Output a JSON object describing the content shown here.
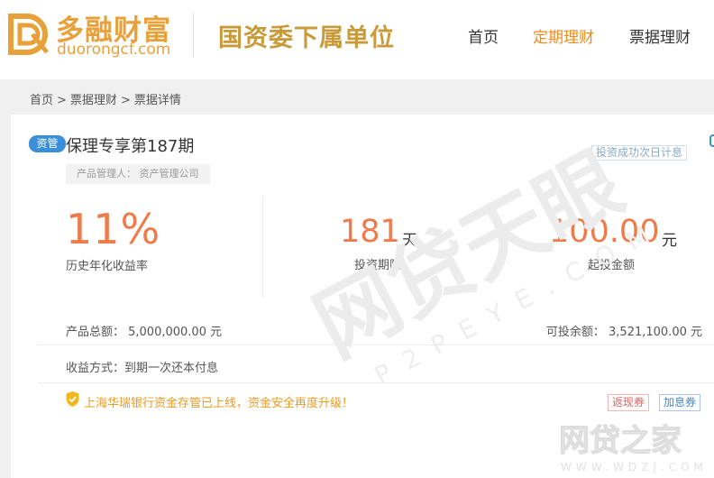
{
  "header": {
    "logo_cn": "多融财富",
    "logo_en": "duorongcf.com",
    "slogan": "国资委下属单位",
    "nav": [
      {
        "label": "首页"
      },
      {
        "label": "定期理财"
      },
      {
        "label": "票据理财"
      }
    ],
    "active_color": "#f08a1d",
    "brand_color": "#e8a13a"
  },
  "breadcrumb": [
    "首页",
    ">",
    "票据理财",
    ">",
    "票据详情"
  ],
  "product": {
    "badge": "资管",
    "title": "保理专享第187期",
    "manager": "产品管理人： 资产管理公司",
    "interest_start": "投资成功次日计息",
    "rate_value": "11%",
    "rate_label": "历史年化收益率",
    "term_value": "181",
    "term_unit": "天",
    "term_label": "投资期限",
    "min_value": "100.00",
    "min_unit": "元",
    "min_label": "起投金额",
    "total": "产品总额： 5,000,000.00 元",
    "remaining": "可投余额： 3,521,100.00 元",
    "repay": "收益方式：到期一次还本付息",
    "notice": "上海华瑞银行资金存管已上线，资金安全再度升级！",
    "tag_cash": "返现券",
    "tag_rate": "加息券"
  },
  "watermarks": {
    "p2peye_cn": "网贷天眼",
    "p2peye_en": "P2PEYE.COM",
    "wdzj_cn": "网贷之家",
    "wdzj_en": "WWW.WDZJ.COM"
  },
  "colors": {
    "accent_orange": "#ef7a4a",
    "badge_blue": "#3b8fd8",
    "notice": "#ee9a1f"
  }
}
